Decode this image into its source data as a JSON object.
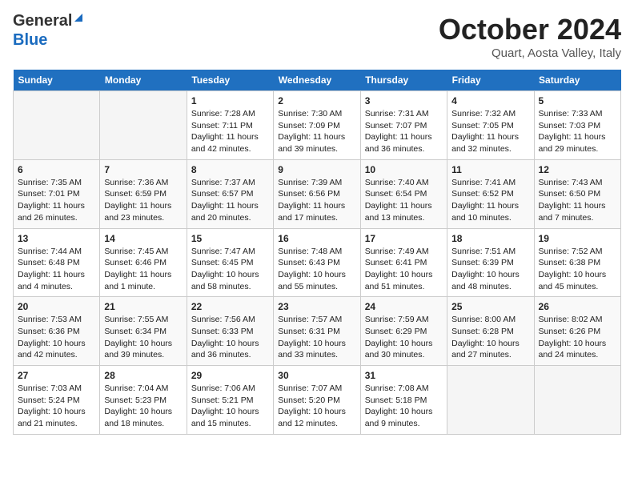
{
  "header": {
    "logo_general": "General",
    "logo_blue": "Blue",
    "title": "October 2024",
    "location": "Quart, Aosta Valley, Italy"
  },
  "days_of_week": [
    "Sunday",
    "Monday",
    "Tuesday",
    "Wednesday",
    "Thursday",
    "Friday",
    "Saturday"
  ],
  "weeks": [
    [
      {
        "day": "",
        "sunrise": "",
        "sunset": "",
        "daylight": ""
      },
      {
        "day": "",
        "sunrise": "",
        "sunset": "",
        "daylight": ""
      },
      {
        "day": "1",
        "sunrise": "Sunrise: 7:28 AM",
        "sunset": "Sunset: 7:11 PM",
        "daylight": "Daylight: 11 hours and 42 minutes."
      },
      {
        "day": "2",
        "sunrise": "Sunrise: 7:30 AM",
        "sunset": "Sunset: 7:09 PM",
        "daylight": "Daylight: 11 hours and 39 minutes."
      },
      {
        "day": "3",
        "sunrise": "Sunrise: 7:31 AM",
        "sunset": "Sunset: 7:07 PM",
        "daylight": "Daylight: 11 hours and 36 minutes."
      },
      {
        "day": "4",
        "sunrise": "Sunrise: 7:32 AM",
        "sunset": "Sunset: 7:05 PM",
        "daylight": "Daylight: 11 hours and 32 minutes."
      },
      {
        "day": "5",
        "sunrise": "Sunrise: 7:33 AM",
        "sunset": "Sunset: 7:03 PM",
        "daylight": "Daylight: 11 hours and 29 minutes."
      }
    ],
    [
      {
        "day": "6",
        "sunrise": "Sunrise: 7:35 AM",
        "sunset": "Sunset: 7:01 PM",
        "daylight": "Daylight: 11 hours and 26 minutes."
      },
      {
        "day": "7",
        "sunrise": "Sunrise: 7:36 AM",
        "sunset": "Sunset: 6:59 PM",
        "daylight": "Daylight: 11 hours and 23 minutes."
      },
      {
        "day": "8",
        "sunrise": "Sunrise: 7:37 AM",
        "sunset": "Sunset: 6:57 PM",
        "daylight": "Daylight: 11 hours and 20 minutes."
      },
      {
        "day": "9",
        "sunrise": "Sunrise: 7:39 AM",
        "sunset": "Sunset: 6:56 PM",
        "daylight": "Daylight: 11 hours and 17 minutes."
      },
      {
        "day": "10",
        "sunrise": "Sunrise: 7:40 AM",
        "sunset": "Sunset: 6:54 PM",
        "daylight": "Daylight: 11 hours and 13 minutes."
      },
      {
        "day": "11",
        "sunrise": "Sunrise: 7:41 AM",
        "sunset": "Sunset: 6:52 PM",
        "daylight": "Daylight: 11 hours and 10 minutes."
      },
      {
        "day": "12",
        "sunrise": "Sunrise: 7:43 AM",
        "sunset": "Sunset: 6:50 PM",
        "daylight": "Daylight: 11 hours and 7 minutes."
      }
    ],
    [
      {
        "day": "13",
        "sunrise": "Sunrise: 7:44 AM",
        "sunset": "Sunset: 6:48 PM",
        "daylight": "Daylight: 11 hours and 4 minutes."
      },
      {
        "day": "14",
        "sunrise": "Sunrise: 7:45 AM",
        "sunset": "Sunset: 6:46 PM",
        "daylight": "Daylight: 11 hours and 1 minute."
      },
      {
        "day": "15",
        "sunrise": "Sunrise: 7:47 AM",
        "sunset": "Sunset: 6:45 PM",
        "daylight": "Daylight: 10 hours and 58 minutes."
      },
      {
        "day": "16",
        "sunrise": "Sunrise: 7:48 AM",
        "sunset": "Sunset: 6:43 PM",
        "daylight": "Daylight: 10 hours and 55 minutes."
      },
      {
        "day": "17",
        "sunrise": "Sunrise: 7:49 AM",
        "sunset": "Sunset: 6:41 PM",
        "daylight": "Daylight: 10 hours and 51 minutes."
      },
      {
        "day": "18",
        "sunrise": "Sunrise: 7:51 AM",
        "sunset": "Sunset: 6:39 PM",
        "daylight": "Daylight: 10 hours and 48 minutes."
      },
      {
        "day": "19",
        "sunrise": "Sunrise: 7:52 AM",
        "sunset": "Sunset: 6:38 PM",
        "daylight": "Daylight: 10 hours and 45 minutes."
      }
    ],
    [
      {
        "day": "20",
        "sunrise": "Sunrise: 7:53 AM",
        "sunset": "Sunset: 6:36 PM",
        "daylight": "Daylight: 10 hours and 42 minutes."
      },
      {
        "day": "21",
        "sunrise": "Sunrise: 7:55 AM",
        "sunset": "Sunset: 6:34 PM",
        "daylight": "Daylight: 10 hours and 39 minutes."
      },
      {
        "day": "22",
        "sunrise": "Sunrise: 7:56 AM",
        "sunset": "Sunset: 6:33 PM",
        "daylight": "Daylight: 10 hours and 36 minutes."
      },
      {
        "day": "23",
        "sunrise": "Sunrise: 7:57 AM",
        "sunset": "Sunset: 6:31 PM",
        "daylight": "Daylight: 10 hours and 33 minutes."
      },
      {
        "day": "24",
        "sunrise": "Sunrise: 7:59 AM",
        "sunset": "Sunset: 6:29 PM",
        "daylight": "Daylight: 10 hours and 30 minutes."
      },
      {
        "day": "25",
        "sunrise": "Sunrise: 8:00 AM",
        "sunset": "Sunset: 6:28 PM",
        "daylight": "Daylight: 10 hours and 27 minutes."
      },
      {
        "day": "26",
        "sunrise": "Sunrise: 8:02 AM",
        "sunset": "Sunset: 6:26 PM",
        "daylight": "Daylight: 10 hours and 24 minutes."
      }
    ],
    [
      {
        "day": "27",
        "sunrise": "Sunrise: 7:03 AM",
        "sunset": "Sunset: 5:24 PM",
        "daylight": "Daylight: 10 hours and 21 minutes."
      },
      {
        "day": "28",
        "sunrise": "Sunrise: 7:04 AM",
        "sunset": "Sunset: 5:23 PM",
        "daylight": "Daylight: 10 hours and 18 minutes."
      },
      {
        "day": "29",
        "sunrise": "Sunrise: 7:06 AM",
        "sunset": "Sunset: 5:21 PM",
        "daylight": "Daylight: 10 hours and 15 minutes."
      },
      {
        "day": "30",
        "sunrise": "Sunrise: 7:07 AM",
        "sunset": "Sunset: 5:20 PM",
        "daylight": "Daylight: 10 hours and 12 minutes."
      },
      {
        "day": "31",
        "sunrise": "Sunrise: 7:08 AM",
        "sunset": "Sunset: 5:18 PM",
        "daylight": "Daylight: 10 hours and 9 minutes."
      },
      {
        "day": "",
        "sunrise": "",
        "sunset": "",
        "daylight": ""
      },
      {
        "day": "",
        "sunrise": "",
        "sunset": "",
        "daylight": ""
      }
    ]
  ]
}
